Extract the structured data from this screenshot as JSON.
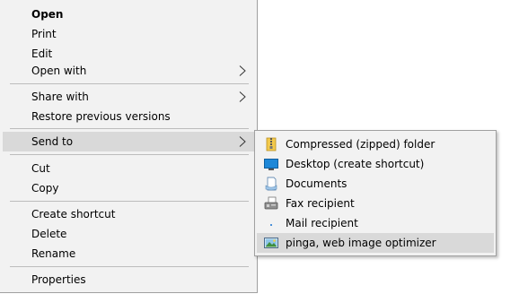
{
  "context_menu": {
    "items": [
      {
        "label": "Open",
        "bold": true
      },
      {
        "label": "Print"
      },
      {
        "label": "Edit"
      },
      {
        "label": "Open with",
        "has_submenu": true
      },
      {
        "label": "Share with",
        "has_submenu": true
      },
      {
        "label": "Restore previous versions"
      },
      {
        "label": "Send to",
        "has_submenu": true,
        "highlighted": true
      },
      {
        "label": "Cut"
      },
      {
        "label": "Copy"
      },
      {
        "label": "Create shortcut"
      },
      {
        "label": "Delete"
      },
      {
        "label": "Rename"
      },
      {
        "label": "Properties"
      }
    ]
  },
  "send_to_submenu": {
    "items": [
      {
        "label": "Compressed (zipped) folder",
        "icon": "zip-folder-icon"
      },
      {
        "label": "Desktop (create shortcut)",
        "icon": "desktop-icon"
      },
      {
        "label": "Documents",
        "icon": "documents-icon"
      },
      {
        "label": "Fax recipient",
        "icon": "fax-icon"
      },
      {
        "label": "Mail recipient",
        "icon": "mail-icon"
      },
      {
        "label": "pinga, web image optimizer",
        "icon": "image-optimizer-icon",
        "highlighted": true
      }
    ]
  },
  "colors": {
    "menu_background": "#f2f2f2",
    "highlight": "#d9d9d9",
    "separator": "#bcbcbc",
    "border": "#a0a0a0"
  }
}
